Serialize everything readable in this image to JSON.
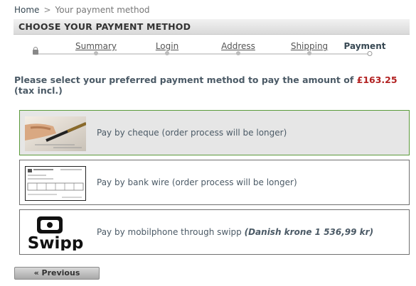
{
  "breadcrumb": {
    "home": "Home",
    "separator": ">",
    "current": "Your payment method"
  },
  "heading": "CHOOSE YOUR PAYMENT METHOD",
  "steps": [
    {
      "label": "Summary",
      "current": false
    },
    {
      "label": "Login",
      "current": false
    },
    {
      "label": "Address",
      "current": false
    },
    {
      "label": "Shipping",
      "current": false
    },
    {
      "label": "Payment",
      "current": true
    }
  ],
  "prompt": {
    "before": "Please select your preferred payment method to pay the amount of ",
    "amount": "£163.25",
    "after": " (tax incl.)"
  },
  "options": [
    {
      "label": "Pay by cheque (order process will be longer)",
      "icon": "cheque-pen-icon",
      "selected": true
    },
    {
      "label": "Pay by bank wire (order process will be longer)",
      "icon": "bank-wire-document-icon",
      "selected": false
    },
    {
      "label": "Pay by mobilphone through swipp ",
      "label_extra": "(Danish krone 1 536,99 kr)",
      "icon": "swipp-logo",
      "logo_text": "Swipp",
      "selected": false
    }
  ],
  "previous_button": "« Previous",
  "colors": {
    "amount": "#b22222",
    "selected_border": "#5a9a3a"
  }
}
